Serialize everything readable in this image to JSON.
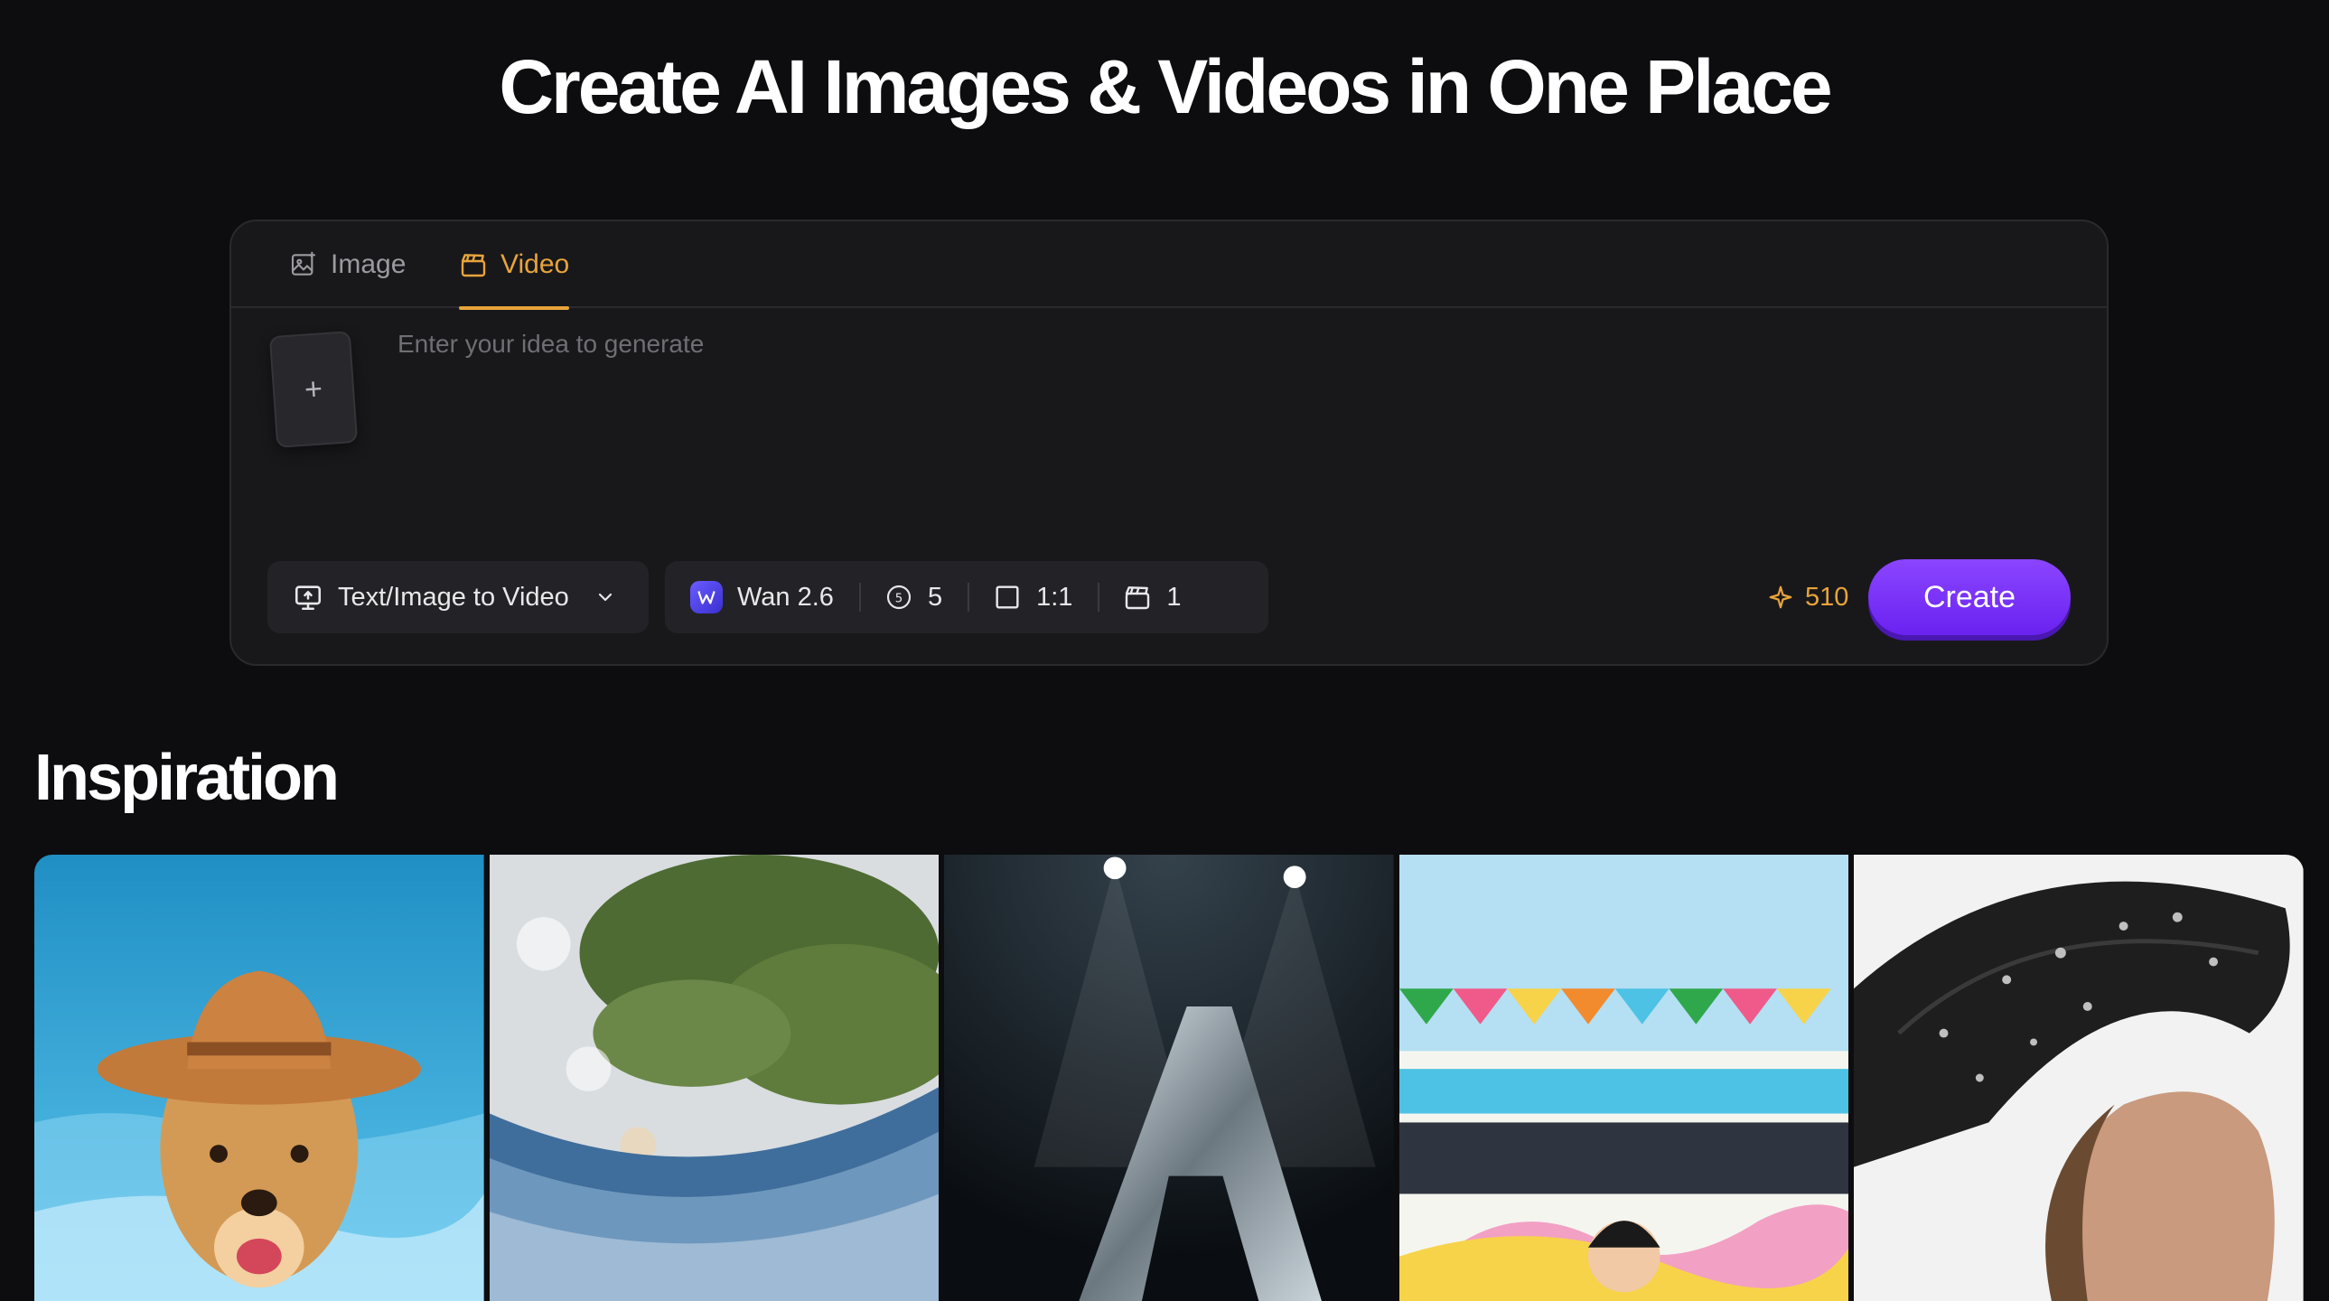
{
  "page_title": "Create AI Images & Videos in One Place",
  "tabs": [
    {
      "label": "Image",
      "icon": "image-icon",
      "active": false
    },
    {
      "label": "Video",
      "icon": "clapperboard-icon",
      "active": true
    }
  ],
  "prompt": {
    "placeholder": "Enter your idea to generate",
    "value": "",
    "upload_icon": "plus-icon"
  },
  "mode": {
    "label": "Text/Image to Video",
    "icon": "monitor-upload-icon"
  },
  "settings": {
    "model": "Wan 2.6",
    "duration": "5",
    "aspect_ratio": "1:1",
    "count": "1"
  },
  "credits": "510",
  "create_label": "Create",
  "inspiration": {
    "title": "Inspiration",
    "items": [
      {
        "name": "dog-cowboy-hat"
      },
      {
        "name": "trees-bokeh-water"
      },
      {
        "name": "metal-letter-a-spotlight"
      },
      {
        "name": "girl-bus-bunting"
      },
      {
        "name": "woman-umbrella-rain"
      }
    ]
  },
  "colors": {
    "background": "#0d0d0f",
    "panel": "#18181b",
    "accent_orange": "#e8a43a",
    "accent_purple": "#7b35f8"
  }
}
